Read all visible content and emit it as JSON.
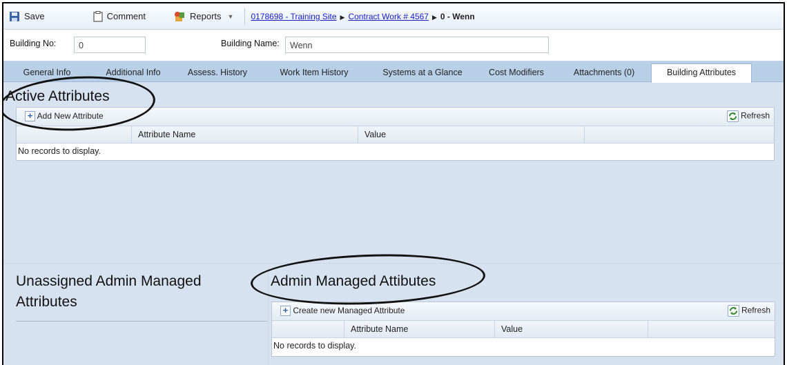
{
  "toolbar": {
    "save_label": "Save",
    "comment_label": "Comment",
    "reports_label": "Reports",
    "breadcrumb": {
      "site": "0178698 - Training Site",
      "contract": "Contract Work # 4567",
      "current": "0 - Wenn"
    }
  },
  "building": {
    "no_label": "Building No:",
    "no_value": "0",
    "name_label": "Building Name:",
    "name_value": "Wenn"
  },
  "tabs": [
    {
      "label": "General Info"
    },
    {
      "label": "Additional Info"
    },
    {
      "label": "Assess. History"
    },
    {
      "label": "Work Item History"
    },
    {
      "label": "Systems at a Glance"
    },
    {
      "label": "Cost Modifiers"
    },
    {
      "label": "Attachments (0)"
    },
    {
      "label": "Building Attributes",
      "active": true
    }
  ],
  "active_attributes": {
    "heading": "Active Attributes",
    "add_label": "Add New Attribute",
    "refresh_label": "Refresh",
    "columns": [
      "Attribute Name",
      "Value"
    ],
    "empty_text": "No records to display."
  },
  "unassigned": {
    "heading": "Unassigned Admin Managed Attributes"
  },
  "admin_managed": {
    "heading": "Admin Managed Attibutes",
    "add_label": "Create new Managed Attribute",
    "refresh_label": "Refresh",
    "columns": [
      "Attribute Name",
      "Value"
    ],
    "empty_text": "No records to display."
  },
  "colors": {
    "background": "#d6e2f0",
    "tab_strip": "#b9cfe8",
    "link": "#1a1acc",
    "annotation": "#111111"
  }
}
